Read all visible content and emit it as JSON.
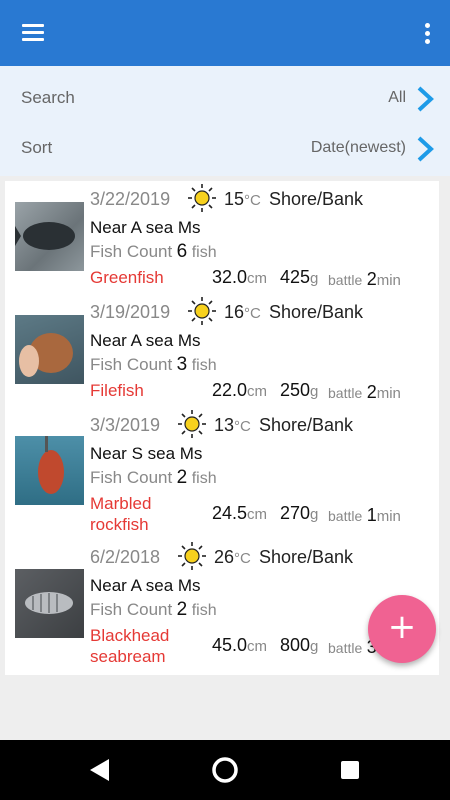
{
  "colors": {
    "appbar": "#2979d2",
    "accent": "#1e9be8",
    "species": "#e53935",
    "fab": "#f06292",
    "sun": "#f7d11e"
  },
  "appbar": {
    "menu_icon": "menu-icon",
    "overflow_icon": "more-vert-icon"
  },
  "filters": {
    "search": {
      "label": "Search",
      "value": "All"
    },
    "sort": {
      "label": "Sort",
      "value": "Date(newest)"
    }
  },
  "labels": {
    "fish_count": "Fish Count",
    "fish_unit": "fish",
    "temp_unit": "°C",
    "length_unit": "cm",
    "weight_unit": "g",
    "battle": "battle",
    "time_unit": "min"
  },
  "records": [
    {
      "date": "3/22/2019",
      "weather": "sunny-icon",
      "temperature": "15",
      "spot": "Shore/Bank",
      "location": "Near A sea Ms",
      "fish_count": "6",
      "species": "Greenfish",
      "length": "32.0",
      "weight": "425",
      "battle": "2"
    },
    {
      "date": "3/19/2019",
      "weather": "sunny-icon",
      "temperature": "16",
      "spot": "Shore/Bank",
      "location": "Near A sea Ms",
      "fish_count": "3",
      "species": "Filefish",
      "length": "22.0",
      "weight": "250",
      "battle": "2"
    },
    {
      "date": "3/3/2019",
      "weather": "sunny-icon",
      "temperature": "13",
      "spot": "Shore/Bank",
      "location": "Near S sea Ms",
      "fish_count": "2",
      "species": "Marbled rockfish",
      "length": "24.5",
      "weight": "270",
      "battle": "1"
    },
    {
      "date": "6/2/2018",
      "weather": "sunny-icon",
      "temperature": "26",
      "spot": "Shore/Bank",
      "location": "Near A sea Ms",
      "fish_count": "2",
      "species": "Blackhead seabream",
      "length": "45.0",
      "weight": "800",
      "battle": "3"
    }
  ],
  "fab": {
    "label": "+",
    "icon": "add-icon"
  },
  "navbar": {
    "back_icon": "back-icon",
    "home_icon": "home-icon",
    "recents_icon": "recents-icon"
  }
}
